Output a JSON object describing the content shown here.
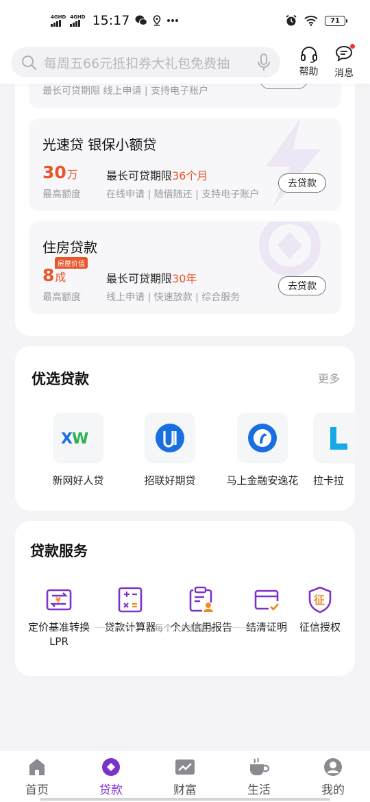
{
  "status_bar": {
    "sim1": "4GHD",
    "sim2": "4GHD",
    "time": "15:17",
    "battery": "71",
    "icons": [
      "wechat-icon",
      "location-icon",
      "more-dots-icon",
      "alarm-icon",
      "wifi-icon"
    ]
  },
  "header": {
    "search_placeholder": "每周五66元抵扣券大礼包免费抽",
    "help_label": "帮助",
    "message_label": "消息"
  },
  "top_card": {
    "partial_item": {
      "tags": "最长可贷期限  线上申请 | 支持电子账户"
    },
    "loans": [
      {
        "title": "光速贷 银保小额贷",
        "amount": "30",
        "unit": "万",
        "amount_label": "最高额度",
        "term_prefix": "最长可贷期限",
        "term_value": "36个月",
        "tags": "在线申请 | 随借随还 | 支持电子账户",
        "button": "去贷款"
      },
      {
        "title": "住房贷款",
        "badge": "房屋价值",
        "amount": "8",
        "unit": "成",
        "amount_label": "最高额度",
        "term_prefix": "最长可贷期限",
        "term_value": "30年",
        "tags": "线上申请 | 快速放款 | 综合服务",
        "button": "去贷款"
      }
    ]
  },
  "preferred": {
    "title": "优选贷款",
    "more": "更多",
    "products": [
      {
        "name": "新网好人贷",
        "logo_text": "XW"
      },
      {
        "name": "招联好期贷",
        "logo_text": "μ"
      },
      {
        "name": "马上金融安逸花",
        "logo_text": ""
      },
      {
        "name": "拉卡拉",
        "logo_text": ""
      }
    ]
  },
  "services": {
    "title": "贷款服务",
    "items": [
      {
        "name": "定价基准转换LPR",
        "line1": "定价基准转换",
        "line2": "LPR",
        "icon": "rate-convert-icon"
      },
      {
        "name": "贷款计算器",
        "icon": "calculator-icon"
      },
      {
        "name": "个人信用报告",
        "icon": "credit-report-icon"
      },
      {
        "name": "结清证明",
        "icon": "settlement-certificate-icon"
      },
      {
        "name": "征信授权",
        "icon": "credit-authorization-icon"
      }
    ]
  },
  "footer": {
    "slogan": "每个人的财富+"
  },
  "tabbar": {
    "tabs": [
      {
        "label": "首页",
        "icon": "home-icon"
      },
      {
        "label": "贷款",
        "icon": "loan-icon",
        "active": true
      },
      {
        "label": "财富",
        "icon": "wealth-icon"
      },
      {
        "label": "生活",
        "icon": "life-icon"
      },
      {
        "label": "我的",
        "icon": "profile-icon"
      }
    ]
  },
  "colors": {
    "accent_purple": "#7b32c8",
    "highlight_orange": "#e8562b",
    "brand_blue": "#1a6fe0",
    "brand_green": "#2bb24c",
    "notification_red": "#f5313b"
  }
}
